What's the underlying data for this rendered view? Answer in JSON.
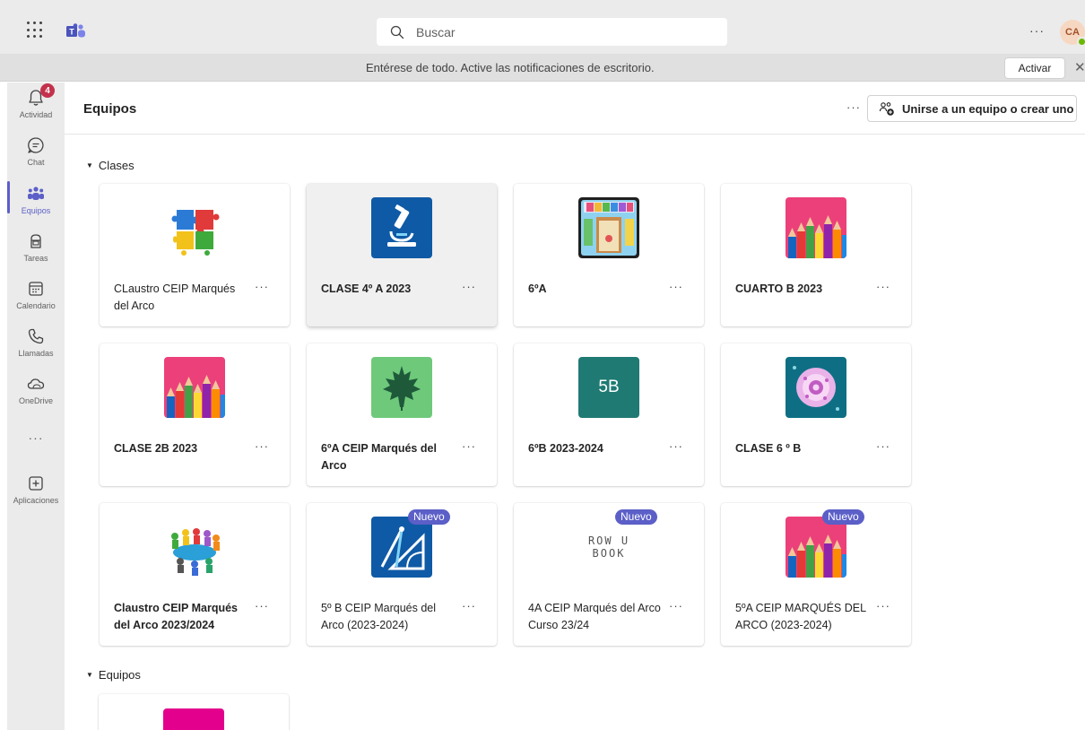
{
  "titlebar": {
    "search_placeholder": "Buscar",
    "more": "···",
    "avatar_initials": "CA"
  },
  "notification": {
    "text": "Entérese de todo. Active las notificaciones de escritorio.",
    "activate_label": "Activar",
    "close": "✕"
  },
  "rail": {
    "items": [
      {
        "label": "Actividad",
        "icon": "bell-icon",
        "badge": "4"
      },
      {
        "label": "Chat",
        "icon": "chat-icon"
      },
      {
        "label": "Equipos",
        "icon": "teams-icon",
        "active": true
      },
      {
        "label": "Tareas",
        "icon": "assignments-icon"
      },
      {
        "label": "Calendario",
        "icon": "calendar-icon"
      },
      {
        "label": "Llamadas",
        "icon": "phone-icon"
      },
      {
        "label": "OneDrive",
        "icon": "cloud-icon"
      },
      {
        "label": "Aplicaciones",
        "icon": "add-apps-icon"
      }
    ],
    "more": "···"
  },
  "header": {
    "title": "Equipos",
    "more": "···",
    "join_label": "Unirse a un equipo o crear uno"
  },
  "sections": {
    "classes_label": "Clases",
    "teams_label": "Equipos"
  },
  "cards": [
    {
      "name": "CLaustro CEIP Marqués del Arco",
      "thumb": "puzzle-people",
      "bold": false
    },
    {
      "name": "CLASE 4º A 2023",
      "thumb": "microscope",
      "bold": true
    },
    {
      "name": "6ºA",
      "thumb": "welcome-door",
      "bold": true
    },
    {
      "name": "CUARTO B 2023",
      "thumb": "pencils",
      "bold": true
    },
    {
      "name": "CLASE 2B 2023",
      "thumb": "pencils",
      "bold": true
    },
    {
      "name": "6ºA CEIP Marqués del Arco",
      "thumb": "maple-leaf",
      "bold": true
    },
    {
      "name": "6ºB 2023-2024",
      "thumb": "initials",
      "initials": "5B",
      "bold": true
    },
    {
      "name": "CLASE 6 º B",
      "thumb": "cell",
      "bold": true
    },
    {
      "name": "Claustro CEIP Marqués del Arco 2023/2024",
      "thumb": "meeting-table",
      "bold": true
    },
    {
      "name": "5º B CEIP Marqués del Arco (2023-2024)",
      "thumb": "geometry",
      "bold": false,
      "badge": "Nuevo"
    },
    {
      "name": "4A CEIP Marqués del Arco Curso 23/24",
      "thumb": "grow-text",
      "bold": false,
      "badge": "Nuevo"
    },
    {
      "name": "5ºA CEIP MARQUÉS DEL ARCO (2023-2024)",
      "thumb": "pencils",
      "bold": false,
      "badge": "Nuevo"
    }
  ],
  "card_more": "···",
  "thumb_text": {
    "grow_line1": "ROW U",
    "grow_line2": "BOOK"
  },
  "colors": {
    "brand": "#5b5fc7",
    "badge_red": "#c4314b",
    "rail_bg": "#ebebeb"
  }
}
